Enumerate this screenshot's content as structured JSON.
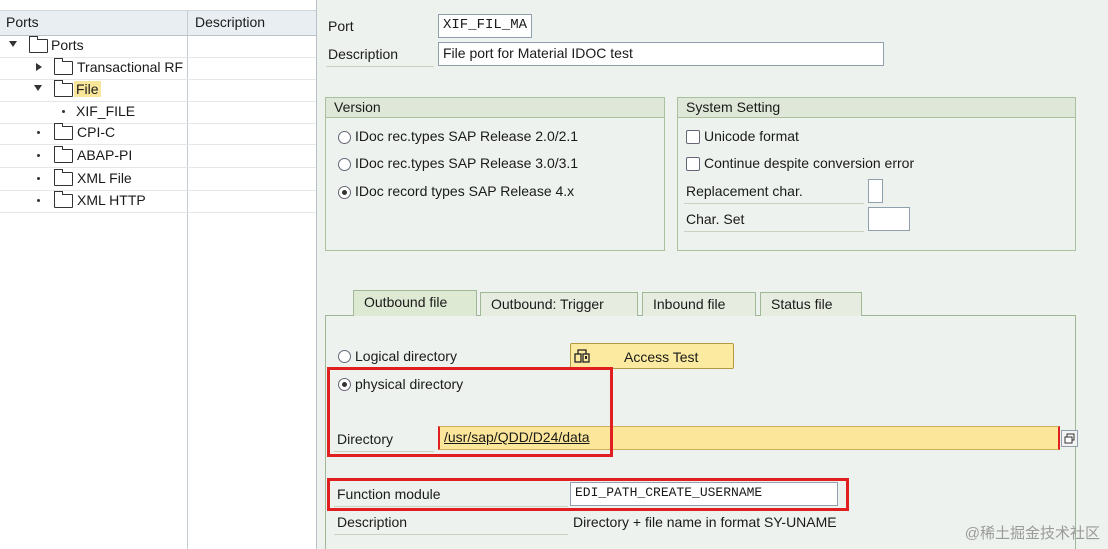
{
  "tree": {
    "headers": {
      "ports": "Ports",
      "description": "Description"
    },
    "items": [
      {
        "label": "Ports",
        "level": 0,
        "state": "expanded"
      },
      {
        "label": "Transactional RF",
        "level": 1,
        "state": "collapsed"
      },
      {
        "label": "File",
        "level": 1,
        "state": "expanded",
        "highlighted": true
      },
      {
        "label": "XIF_FILE",
        "level": 2,
        "state": "leaf",
        "selected": true
      },
      {
        "label": "CPI-C",
        "level": 1,
        "state": "leaf"
      },
      {
        "label": "ABAP-PI",
        "level": 1,
        "state": "leaf"
      },
      {
        "label": "XML File",
        "level": 1,
        "state": "leaf"
      },
      {
        "label": "XML HTTP",
        "level": 1,
        "state": "leaf"
      }
    ]
  },
  "port": {
    "label": "Port",
    "value": "XIF_FIL_MA"
  },
  "description": {
    "label": "Description",
    "value": "File port for Material IDOC test"
  },
  "version": {
    "title": "Version",
    "options": [
      {
        "label": "IDoc rec.types SAP Release 2.0/2.1",
        "selected": false
      },
      {
        "label": "IDoc rec.types SAP Release 3.0/3.1",
        "selected": false
      },
      {
        "label": "IDoc record types SAP Release 4.x",
        "selected": true
      }
    ]
  },
  "system_setting": {
    "title": "System Setting",
    "unicode_label": "Unicode format",
    "unicode_checked": false,
    "continue_label": "Continue despite conversion error",
    "continue_checked": false,
    "replacement_label": "Replacement char.",
    "replacement_value": "",
    "charset_label": "Char. Set",
    "charset_value": ""
  },
  "tabs": [
    {
      "label": "Outbound file",
      "active": true
    },
    {
      "label": "Outbound: Trigger",
      "active": false
    },
    {
      "label": "Inbound file",
      "active": false
    },
    {
      "label": "Status file",
      "active": false
    }
  ],
  "outbound": {
    "logical_label": "Logical directory",
    "logical_selected": false,
    "physical_label": "physical directory",
    "physical_selected": true,
    "access_test_label": "Access Test",
    "directory_label": "Directory",
    "directory_value": "/usr/sap/QDD/D24/data",
    "function_module_label": "Function module",
    "function_module_value": "EDI_PATH_CREATE_USERNAME",
    "fm_description_label": "Description",
    "fm_description_value": "Directory + file name in format SY-UNAME"
  },
  "watermark": "@稀土掘金技术社区",
  "colors": {
    "highlight": "#fbe69a",
    "red_box": "#e02020",
    "group_header": "#dfe8d8"
  }
}
